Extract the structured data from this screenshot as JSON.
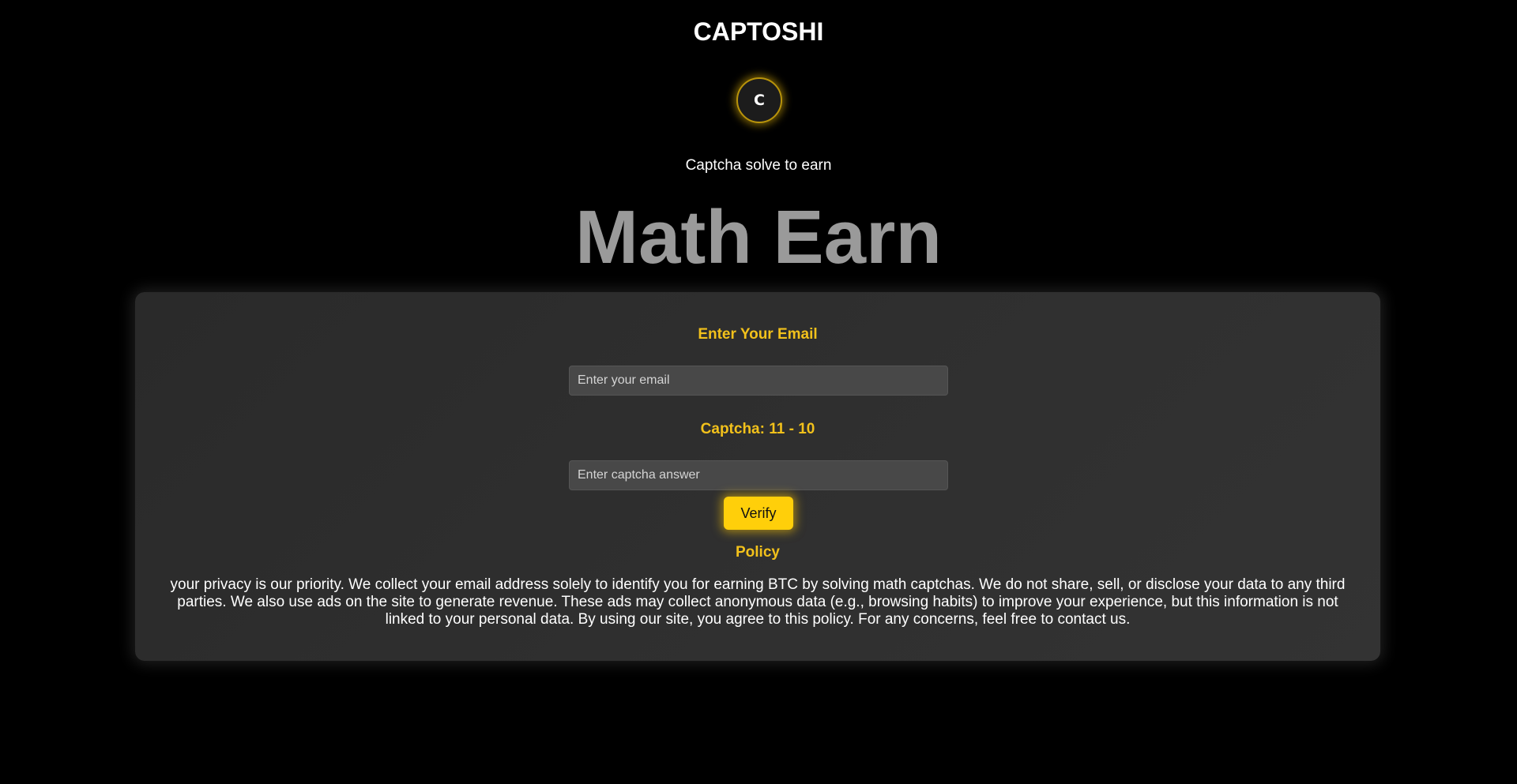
{
  "header": {
    "site_title": "CAPTOSHI",
    "logo_letter": "C",
    "tagline": "Captcha solve to earn",
    "hero_title": "Math Earn"
  },
  "form": {
    "email_heading": "Enter Your Email",
    "email_placeholder": "Enter your email",
    "email_value": "",
    "captcha_heading": "Captcha: 11 - 10",
    "captcha_placeholder": "Enter captcha answer",
    "captcha_value": "",
    "verify_label": "Verify"
  },
  "policy": {
    "heading": "Policy",
    "text": "your privacy is our priority. We collect your email address solely to identify you for earning BTC by solving math captchas. We do not share, sell, or disclose your data to any third parties. We also use ads on the site to generate revenue. These ads may collect anonymous data (e.g., browsing habits) to improve your experience, but this information is not linked to your personal data. By using our site, you agree to this policy. For any concerns, feel free to contact us."
  },
  "colors": {
    "background": "#000000",
    "accent": "#f2c11b",
    "button": "#ffcf0a",
    "hero_text": "#9a9a9a",
    "card": "#2e2e2e"
  }
}
